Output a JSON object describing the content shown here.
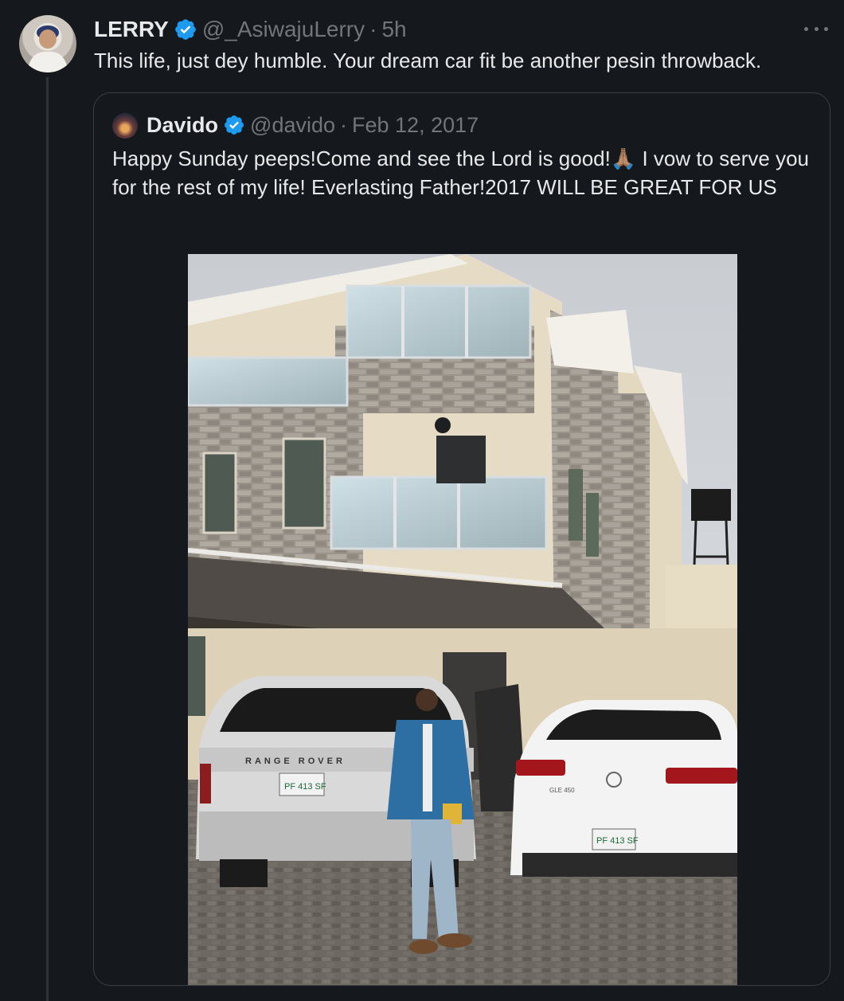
{
  "tweet": {
    "author_name": "LERRY",
    "handle": "@_AsiwajuLerry",
    "separator": "·",
    "time": "5h",
    "text": "This life, just dey humble. Your dream car fit be another pesin throwback."
  },
  "quoted": {
    "author_name": "Davido",
    "handle": "@davido",
    "separator": "·",
    "date": "Feb 12, 2017",
    "text": "Happy Sunday peeps!Come and see the Lord is good!🙏🏽 I vow to serve you for the rest of my life! Everlasting Father!2017 WILL BE GREAT FOR US",
    "photo": {
      "car1_badge": "RANGE ROVER",
      "car1_plate": "PF 413 SF",
      "car2_badge": "GLE 450",
      "car2_plate": "PF 413 SF"
    }
  },
  "colors": {
    "background": "#15181c",
    "verified": "#1d9bf0",
    "muted": "#71767b"
  },
  "icons": {
    "verified": "verified-badge-icon",
    "more": "more-options-icon"
  }
}
